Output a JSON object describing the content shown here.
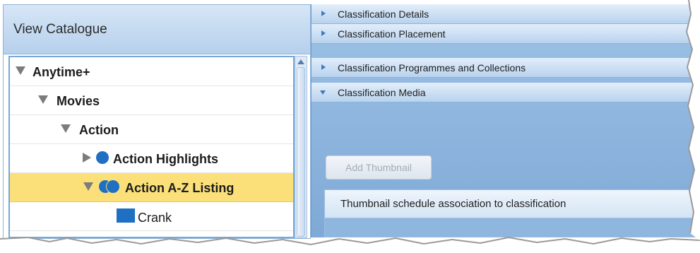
{
  "left_panel": {
    "title": "View Catalogue",
    "tree": [
      {
        "label": "Anytime+",
        "expanded": true,
        "level": 0,
        "icon": "none"
      },
      {
        "label": "Movies",
        "expanded": true,
        "level": 1,
        "icon": "none"
      },
      {
        "label": "Action",
        "expanded": true,
        "level": 2,
        "icon": "none"
      },
      {
        "label": "Action Highlights",
        "expanded": false,
        "level": 3,
        "icon": "blue-circle-icon"
      },
      {
        "label": "Action A-Z Listing",
        "expanded": true,
        "level": 3,
        "icon": "double-blue-circle-icon",
        "selected": true
      },
      {
        "label": "Crank",
        "level": 4,
        "icon": "blue-square-icon"
      }
    ]
  },
  "right_panel": {
    "sections": [
      {
        "label": "Classification Details",
        "expanded": false
      },
      {
        "label": "Classification Placement",
        "expanded": false
      },
      {
        "label": "Classification Programmes and Collections",
        "expanded": false
      },
      {
        "label": "Classification Media",
        "expanded": true
      }
    ],
    "add_thumbnail_label": "Add Thumbnail",
    "schedule_header": "Thumbnail schedule association to classification"
  },
  "colors": {
    "selected_row": "#fbe07a",
    "node_icon_blue": "#1f6fc2",
    "panel_blue": "#9ec2e6"
  }
}
